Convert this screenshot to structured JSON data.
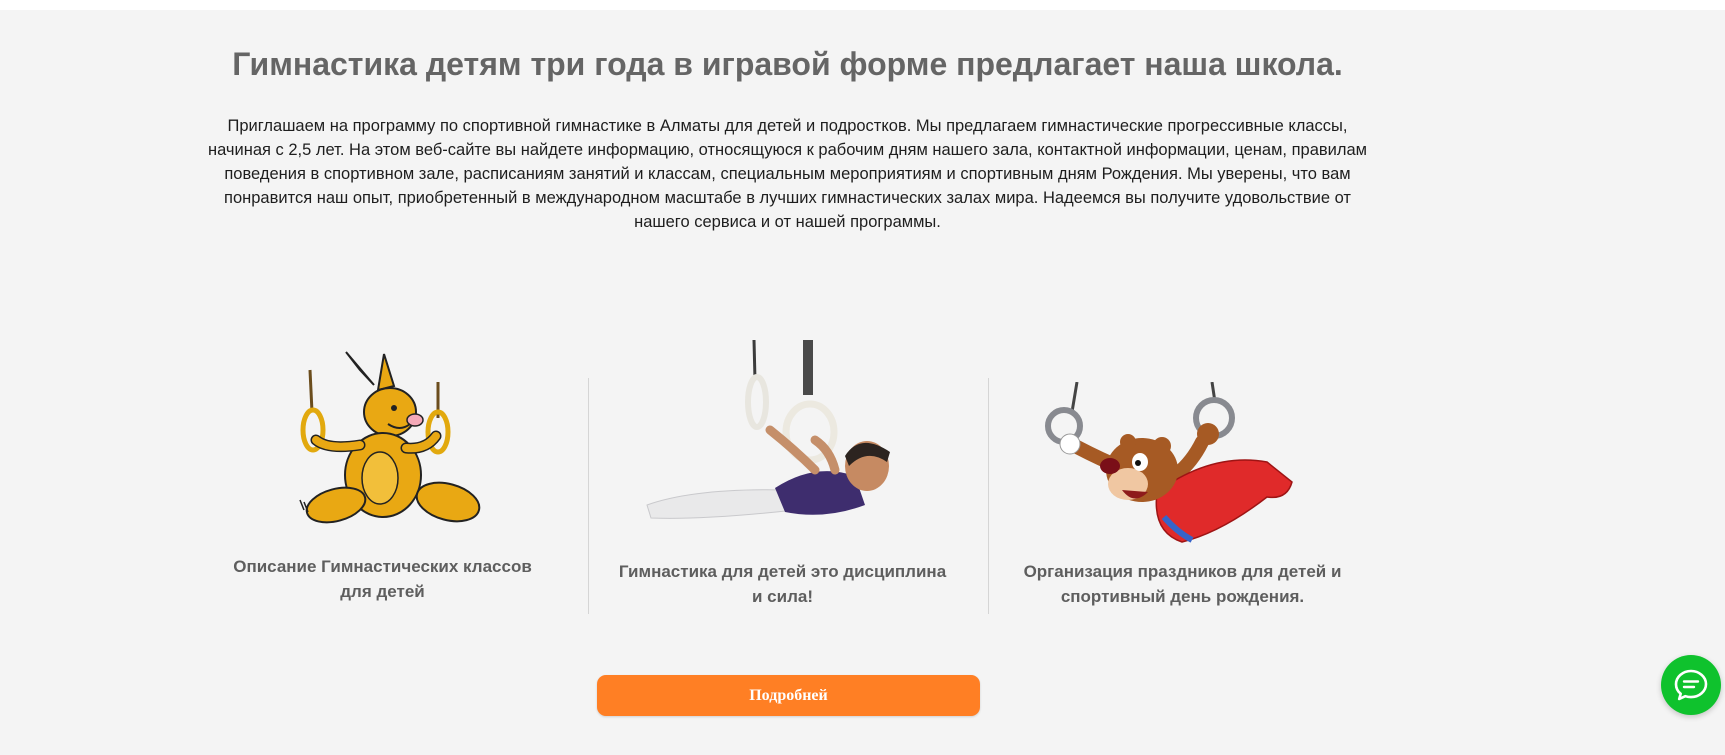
{
  "header": {
    "title": "Гимнастика детям три года в игравой форме предлагает наша школа."
  },
  "intro": {
    "text": "Приглашаем на программу по спортивной гимнастике в Алматы для детей и подростков. Мы предлагаем гимнастические прогрессивные классы, начиная с 2,5 лет. На этом веб-сайте вы найдете информацию, относящуюся к рабочим дням нашего зала, контактной информации, ценам, правилам поведения в спортивном зале, расписаниям занятий и классам, специальным мероприятиям и спортивным дням Рождения. Мы уверены, что вам понравится наш опыт, приобретенный в международном масштабе в лучших гимнастических залах мира. Надеемся вы получите удовольствие от нашего сервиса и от нашей программы."
  },
  "features": [
    {
      "caption_line1": "Описание Гимнастических классов",
      "caption_line2": "для детей",
      "icon": "kangaroo-on-rings"
    },
    {
      "caption_line1": "Гимнастика для детей это дисциплина",
      "caption_line2": "и сила!",
      "icon": "boy-gymnast-on-rings"
    },
    {
      "caption_line1": "Организация праздников для детей и",
      "caption_line2": "спортивный день рождения.",
      "icon": "bear-on-rings"
    }
  ],
  "cta": {
    "label": "Подробней"
  },
  "chat": {
    "icon": "chat-bubble-icon"
  },
  "colors": {
    "background": "#f4f4f4",
    "accent": "#ff7f24",
    "chat": "#0fc22d",
    "title": "#656565"
  }
}
